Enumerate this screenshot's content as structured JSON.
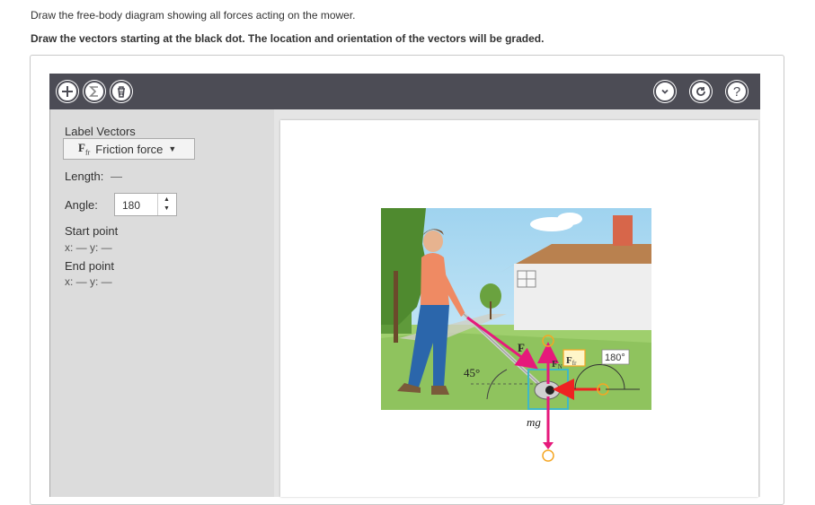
{
  "question": {
    "line1": "Draw the free-body diagram showing all forces acting on the mower.",
    "line2": "Draw the vectors starting at the black dot. The location and orientation of the vectors will be graded."
  },
  "toolbar": {
    "add_icon": "plus-icon",
    "sum_icon": "sigma-icon",
    "delete_icon": "trash-icon",
    "collapse_icon": "chevron-down-icon",
    "reset_icon": "reset-icon",
    "help_icon": "help-icon",
    "help_glyph": "?"
  },
  "side": {
    "label_vectors": "Label Vectors",
    "selected_symbol": "F",
    "selected_sub": "fr",
    "selected_name": "Friction force",
    "length_label": "Length:",
    "length_value": "—",
    "angle_label": "Angle:",
    "angle_value": "180",
    "start_label": "Start point",
    "start_coords": "x: — y: —",
    "end_label": "End point",
    "end_coords": "x: — y: —"
  },
  "scene": {
    "applied_force_label": "F",
    "normal_force_label": "F",
    "normal_force_sub": "N",
    "friction_label": "F",
    "friction_sub": "fr",
    "weight_label": "mg",
    "handle_angle": "45°",
    "angle_readout": "180°",
    "colors": {
      "vector": "#e6197b",
      "friction": "#ee2222",
      "handle_ring": "#f5a623",
      "selection_box": "#3fb8c6"
    }
  }
}
